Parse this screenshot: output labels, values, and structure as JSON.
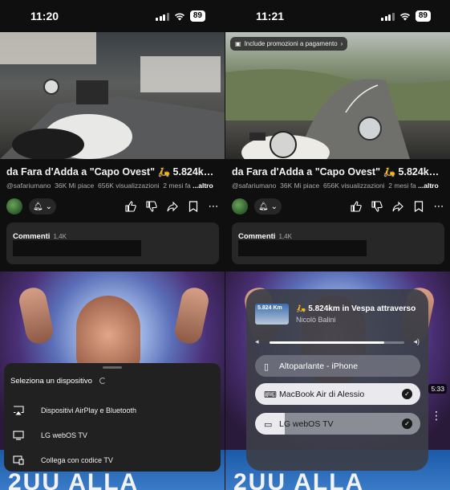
{
  "left": {
    "time": "11:20",
    "battery": "89",
    "video_title": "da Fara d'Adda a \"Capo Ovest\" 🛵 5.824km in...",
    "channel": "@safariumano",
    "likes": "36K Mi piace",
    "views": "656K visualizzazioni",
    "age": "2 mesi fa",
    "more": "...altro",
    "comments_label": "Commenti",
    "comments_count": "1,4K",
    "sheet": {
      "title": "Seleziona un dispositivo",
      "options": [
        {
          "icon": "airplay-icon",
          "label": "Dispositivi AirPlay e Bluetooth"
        },
        {
          "icon": "tv-icon",
          "label": "LG webOS TV"
        },
        {
          "icon": "link-tv-icon",
          "label": "Collega con codice TV"
        }
      ]
    }
  },
  "right": {
    "time": "11:21",
    "battery": "89",
    "promo": "Include promozioni a pagamento",
    "video_title": "da Fara d'Adda a \"Capo Ovest\" 🛵 5.824km in...",
    "channel": "@safariumano",
    "likes": "36K Mi piace",
    "views": "656K visualizzazioni",
    "age": "2 mesi fa",
    "more": "...altro",
    "comments_label": "Commenti",
    "comments_count": "1,4K",
    "duration": "5:33",
    "airplay": {
      "art_text": "5.824 Km",
      "title": "🛵 5.824km in Vespa attraverso",
      "artist": "Nicolò Balini",
      "volume": 0.85,
      "devices": [
        {
          "icon": "phone-icon",
          "label": "Altoparlante - iPhone",
          "selected": false
        },
        {
          "icon": "laptop-icon",
          "label": "MacBook Air di Alessio",
          "selected": true
        },
        {
          "icon": "tv-icon",
          "label": "LG webOS TV",
          "selected": true
        }
      ]
    }
  }
}
